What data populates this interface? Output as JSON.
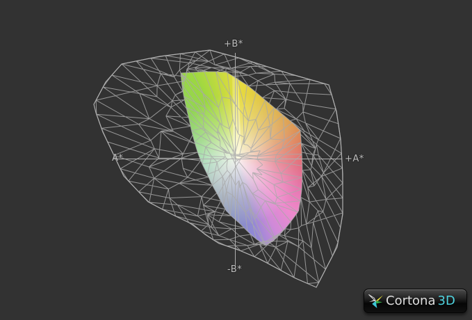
{
  "app": {
    "name": "Cortona3D viewer",
    "background_color": "#323232",
    "content": "3D CIE-Lab color gamut comparison: colored solid display gamut inside a gray wireframe reference gamut mesh"
  },
  "axes": {
    "label_color": "#bcbcbc",
    "labels": {
      "plus_b": "+B*",
      "minus_b": "-B*",
      "a_left": "A*",
      "plus_a": "+A*"
    }
  },
  "logo": {
    "brand": "Cortona",
    "suffix": "3D",
    "brand_color": "#dedede",
    "suffix_color": "#4fd2de"
  },
  "gamut": {
    "wireframe_color": "#a9a9a9",
    "wireframe_outline_color": "#b4b4b4",
    "center": [
      342,
      229
    ],
    "white_core_color": "#fcfaf2",
    "outer_polygon": [
      [
        302,
        72
      ],
      [
        350,
        85
      ],
      [
        420,
        107
      ],
      [
        473,
        122
      ],
      [
        484,
        160
      ],
      [
        490,
        200
      ],
      [
        493,
        250
      ],
      [
        493,
        308
      ],
      [
        485,
        355
      ],
      [
        455,
        413
      ],
      [
        425,
        400
      ],
      [
        373,
        372
      ],
      [
        340,
        358
      ],
      [
        315,
        350
      ],
      [
        295,
        337
      ],
      [
        278,
        323
      ],
      [
        245,
        307
      ],
      [
        213,
        290
      ],
      [
        196,
        272
      ],
      [
        178,
        253
      ],
      [
        160,
        215
      ],
      [
        148,
        190
      ],
      [
        138,
        162
      ],
      [
        135,
        150
      ],
      [
        152,
        118
      ],
      [
        175,
        92
      ],
      [
        230,
        81
      ]
    ],
    "solid_polygon": [
      [
        260,
        105
      ],
      [
        294,
        103
      ],
      [
        325,
        103
      ],
      [
        358,
        124
      ],
      [
        390,
        151
      ],
      [
        418,
        174
      ],
      [
        432,
        187
      ],
      [
        434,
        215
      ],
      [
        435,
        245
      ],
      [
        434,
        275
      ],
      [
        430,
        303
      ],
      [
        412,
        327
      ],
      [
        393,
        347
      ],
      [
        382,
        353
      ],
      [
        362,
        339
      ],
      [
        347,
        323
      ],
      [
        334,
        312
      ],
      [
        325,
        303
      ],
      [
        312,
        278
      ],
      [
        303,
        262
      ],
      [
        297,
        248
      ],
      [
        288,
        230
      ],
      [
        282,
        212
      ],
      [
        276,
        190
      ],
      [
        271,
        167
      ],
      [
        266,
        147
      ],
      [
        262,
        125
      ]
    ],
    "hue_stops": [
      {
        "deg": 0,
        "color": "#e7dd3d"
      },
      {
        "deg": 30,
        "color": "#debb47"
      },
      {
        "deg": 58,
        "color": "#dc9a52"
      },
      {
        "deg": 78,
        "color": "#df7a5e"
      },
      {
        "deg": 95,
        "color": "#e16a7e"
      },
      {
        "deg": 118,
        "color": "#e87ab4"
      },
      {
        "deg": 135,
        "color": "#ee8acd"
      },
      {
        "deg": 152,
        "color": "#cf8ad8"
      },
      {
        "deg": 167,
        "color": "#9188d6"
      },
      {
        "deg": 186,
        "color": "#7e8ed0"
      },
      {
        "deg": 208,
        "color": "#86a4c6"
      },
      {
        "deg": 232,
        "color": "#8abab4"
      },
      {
        "deg": 254,
        "color": "#82ccaa"
      },
      {
        "deg": 274,
        "color": "#85d396"
      },
      {
        "deg": 302,
        "color": "#88d168"
      },
      {
        "deg": 332,
        "color": "#9cd741"
      },
      {
        "deg": 360,
        "color": "#e7dd3d"
      }
    ]
  }
}
